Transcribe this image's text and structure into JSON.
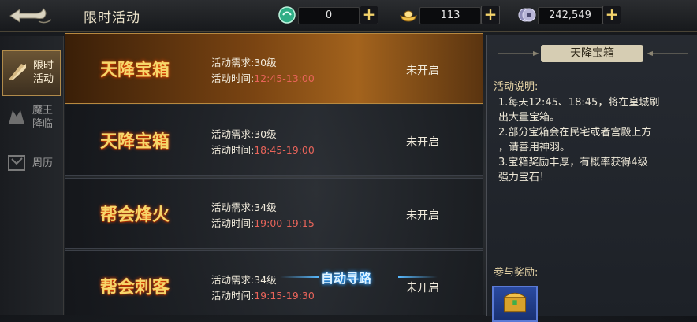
{
  "header": {
    "title": "限时活动",
    "resources": [
      {
        "icon": "jade-coin-icon",
        "value": "0",
        "color": "#4fd3a6"
      },
      {
        "icon": "gold-ingot-icon",
        "value": "113",
        "color": "#f2c14a"
      },
      {
        "icon": "silver-coin-icon",
        "value": "242,549",
        "color": "#b9b6d8"
      }
    ],
    "plus_label": "+"
  },
  "sidebar": {
    "tabs": [
      {
        "label": "限时活动",
        "active": true,
        "icon": "fan-icon"
      },
      {
        "label": "魔王降临",
        "active": false,
        "icon": "demon-icon"
      },
      {
        "label": "周历",
        "active": false,
        "icon": "calendar-icon"
      }
    ]
  },
  "activities": [
    {
      "name": "天降宝箱",
      "requirement": "活动需求:30级",
      "time_label": "活动时间:",
      "time_value": "12:45-13:00",
      "status": "未开启",
      "selected": true
    },
    {
      "name": "天降宝箱",
      "requirement": "活动需求:30级",
      "time_label": "活动时间:",
      "time_value": "18:45-19:00",
      "status": "未开启",
      "selected": false
    },
    {
      "name": "帮会烽火",
      "requirement": "活动需求:34级",
      "time_label": "活动时间:",
      "time_value": "19:00-19:15",
      "status": "未开启",
      "selected": false
    },
    {
      "name": "帮会刺客",
      "requirement": "活动需求:34级",
      "time_label": "活动时间:",
      "time_value": "19:15-19:30",
      "status": "未开启",
      "selected": false
    }
  ],
  "auto_path": {
    "label": "自动寻路"
  },
  "detail": {
    "title": "天降宝箱",
    "description_heading": "活动说明:",
    "description_lines": [
      "1.每天12:45、18:45，将在皇城刷",
      "出大量宝箱。",
      "2.部分宝箱会在民宅或者宫殿上方",
      "，请善用神羽。",
      "3.宝箱奖励丰厚，有概率获得4级",
      "强力宝石！"
    ],
    "reward_heading": "参与奖励:",
    "reward_icon": "treasure-chest-icon"
  },
  "colors": {
    "accent_gold": "#f6d66a",
    "time_red": "#e8645a",
    "selected_row": "#a3631d"
  }
}
